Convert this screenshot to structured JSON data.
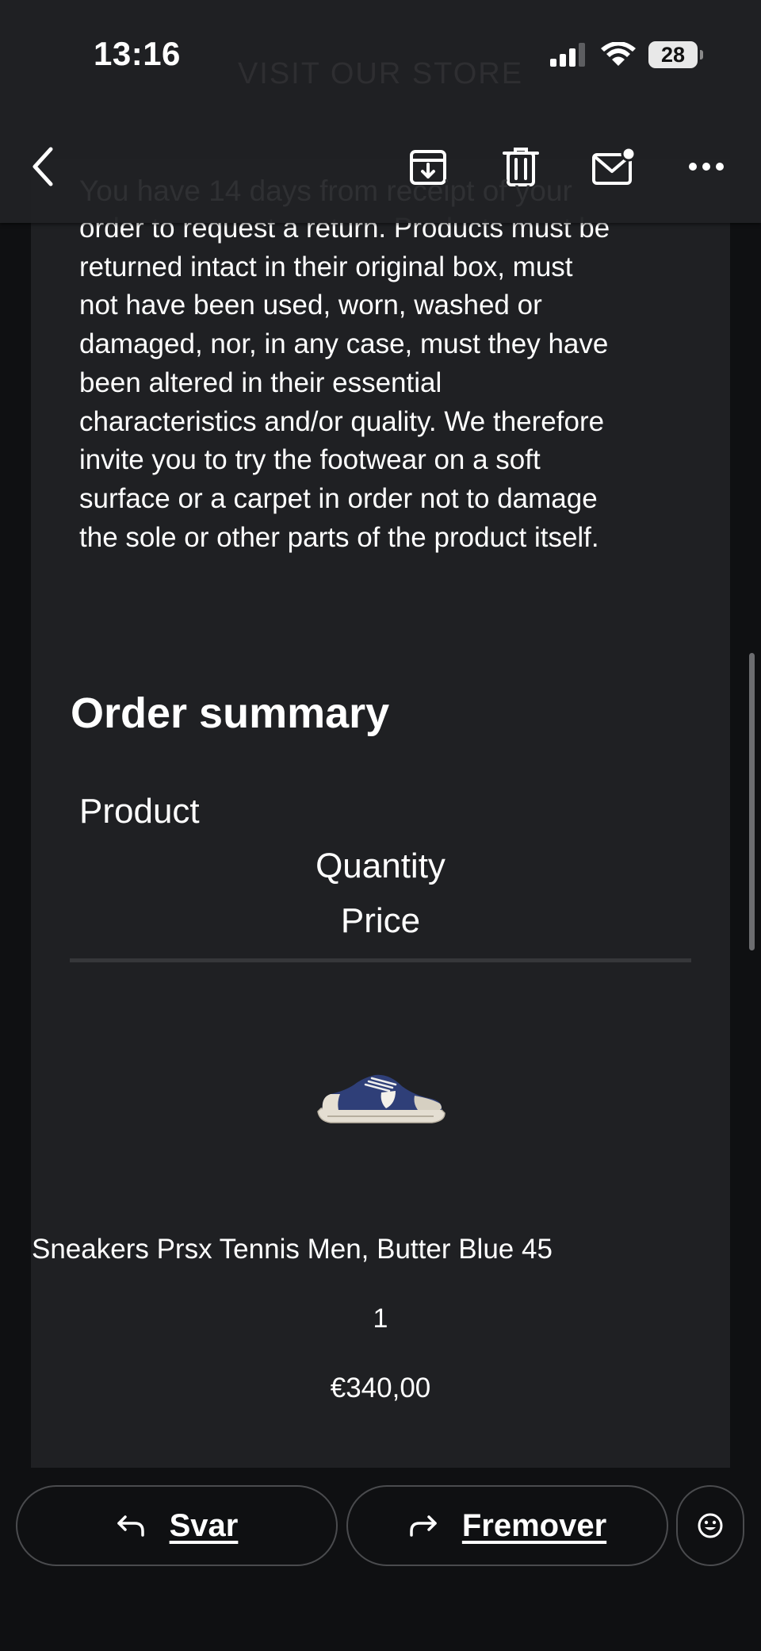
{
  "status_bar": {
    "time": "13:16",
    "battery": "28",
    "icons": [
      "cellular-signal-icon",
      "wifi-icon",
      "battery-icon"
    ]
  },
  "toolbar": {
    "back_icon": "chevron-left-icon",
    "archive_icon": "archive-icon",
    "delete_icon": "trash-icon",
    "mark_unread_icon": "mail-unread-icon",
    "more_icon": "more-horizontal-icon"
  },
  "email": {
    "ghost_store_text": "VISIT OUR STORE",
    "ghost_return_text": "You have 14 days from receipt of your",
    "policy_lines": [
      "order to request a return. Products must be",
      "returned intact in their original box, must",
      "not have been used, worn, washed or",
      "damaged, nor, in any case, must they have",
      "been altered in their essential",
      "characteristics and/or quality. We therefore",
      "invite you to try the footwear on a soft",
      "surface or a carpet in order not to damage",
      "the sole or other parts of the product itself."
    ],
    "order_summary_heading": "Order summary",
    "columns": {
      "product": "Product",
      "quantity": "Quantity",
      "price": "Price"
    },
    "item": {
      "image": "sneaker-image",
      "name": "Sneakers Prsx Tennis Men, Butter Blue 45",
      "quantity": "1",
      "price": "€340,00"
    }
  },
  "actions": {
    "reply_label": "Svar",
    "forward_label": "Fremover",
    "reply_icon": "reply-arrow-icon",
    "forward_icon": "forward-arrow-icon",
    "emoji_icon": "emoji-smile-icon"
  },
  "colors": {
    "background": "#0f1012",
    "panel": "#1f2023",
    "text": "#ffffff",
    "divider": "#36373a"
  }
}
